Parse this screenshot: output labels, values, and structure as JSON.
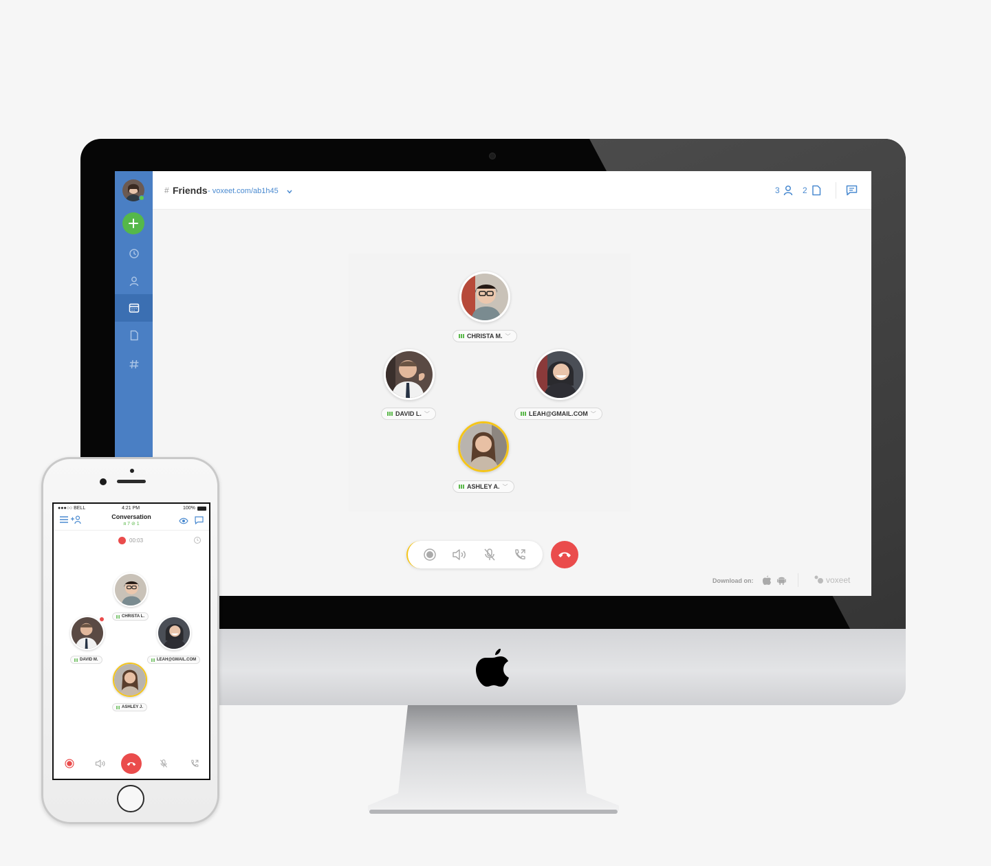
{
  "desktop": {
    "room": {
      "hash": "#",
      "name": "Friends",
      "link": "- voxeet.com/ab1h45"
    },
    "topbar": {
      "participant_count": "3",
      "file_count": "2"
    },
    "participants": [
      {
        "name": "CHRISTA M."
      },
      {
        "name": "DAVID L."
      },
      {
        "name": "LEAH@GMAIL.COM"
      },
      {
        "name": "ASHLEY A."
      }
    ],
    "footer": {
      "download_label": "Download on:",
      "brand": "voxeet"
    },
    "icons": {
      "sidebar": [
        "user-avatar",
        "add-icon",
        "clock-icon",
        "contacts-icon",
        "calendar-icon",
        "file-icon",
        "hash-icon"
      ],
      "controls": [
        "record-icon",
        "speaker-icon",
        "mute-mic-icon",
        "transfer-call-icon",
        "hangup-icon"
      ]
    },
    "colors": {
      "sidebar": "#4a7fc4",
      "accent": "#4a8ad0",
      "hangup": "#ea4c4c",
      "speaking": "#f5c518",
      "online": "#5ecb4a"
    }
  },
  "phone": {
    "status": {
      "carrier": "●●●○○ BELL",
      "time": "4:21 PM",
      "battery": "100%"
    },
    "title": "Conversation",
    "participants_count": "7",
    "links_count": "1",
    "timer": "00:03",
    "participants": [
      {
        "name": "CHRISTA L."
      },
      {
        "name": "DAVID M."
      },
      {
        "name": "LEAH@GMAIL.COM"
      },
      {
        "name": "ASHLEY J."
      }
    ]
  }
}
